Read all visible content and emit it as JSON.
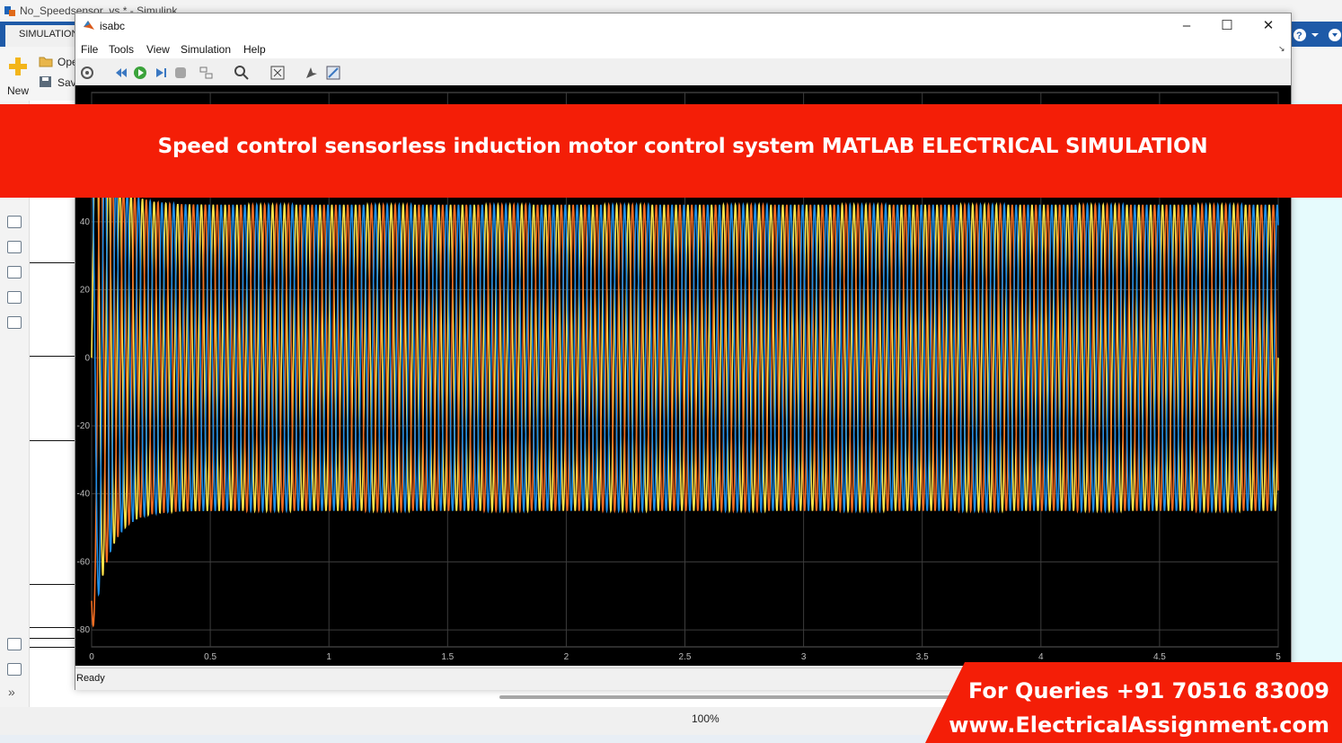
{
  "background_app": {
    "window_title": "No_Speedsensor_vs * - Simulink",
    "ribbon_tab": "SIMULATION",
    "new_label": "New",
    "open_label": "Ope",
    "save_label": "Sav",
    "zoom_level": "100%"
  },
  "scope_window": {
    "title": "isabc",
    "menu": [
      "File",
      "Tools",
      "View",
      "Simulation",
      "Help"
    ],
    "status": "Ready"
  },
  "banner": {
    "headline": "Speed control sensorless induction motor control system MATLAB ELECTRICAL SIMULATION",
    "phone": "For Queries +91 70516 83009",
    "website": "www.ElectricalAssignment.com",
    "color": "#f41e07"
  },
  "chart_data": {
    "type": "line",
    "title": "",
    "xlabel": "",
    "ylabel": "",
    "xlim": [
      0,
      5
    ],
    "ylim": [
      -85,
      78
    ],
    "x_ticks": [
      "0",
      "0.5",
      "1",
      "1.5",
      "2",
      "2.5",
      "3",
      "3.5",
      "4",
      "4.5",
      "5"
    ],
    "y_ticks": [
      "40",
      "20",
      "0",
      "-20",
      "-40",
      "-60",
      "-80"
    ],
    "grid": true,
    "steady_state_amplitude": 45,
    "startup_peak": -66,
    "frequency_hz": 20,
    "series": [
      {
        "color": "#ffe44a",
        "phase_deg": 0
      },
      {
        "color": "#f26d21",
        "phase_deg": -120
      },
      {
        "color": "#1f8ee8",
        "phase_deg": 120
      }
    ]
  }
}
